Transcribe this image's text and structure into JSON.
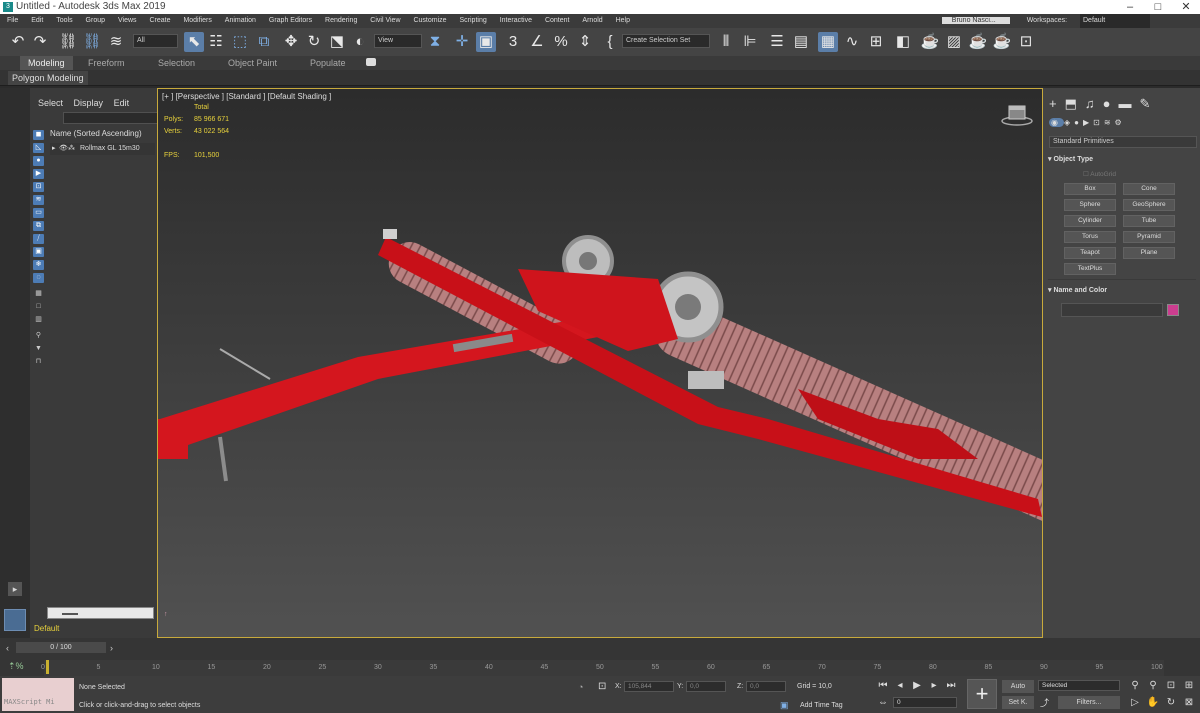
{
  "window": {
    "title": "Untitled - Autodesk 3ds Max 2019"
  },
  "menu": [
    "File",
    "Edit",
    "Tools",
    "Group",
    "Views",
    "Create",
    "Modifiers",
    "Animation",
    "Graph Editors",
    "Rendering",
    "Civil View",
    "Customize",
    "Scripting",
    "Interactive",
    "Content",
    "Arnold",
    "Help"
  ],
  "workspace": {
    "user": "Bruno Nasci...",
    "label": "Workspaces:",
    "value": "Default"
  },
  "toolbar": {
    "filter": "All",
    "coord": "View",
    "selection_set": "Create Selection Set"
  },
  "ribbon": {
    "tabs": [
      "Modeling",
      "Freeform",
      "Selection",
      "Object Paint",
      "Populate"
    ],
    "active": "Modeling",
    "subtab": "Polygon Modeling"
  },
  "scene_explorer": {
    "tabs": [
      "Select",
      "Display",
      "Edit"
    ],
    "column": "Name (Sorted Ascending)",
    "item": "Rollmax GL 15m30",
    "layer": "Default"
  },
  "viewport": {
    "label": "[+ ] [Perspective ] [Standard ] [Default Shading ]",
    "stats_title": "Total",
    "polys_label": "Polys:",
    "polys": "85 966 671",
    "verts_label": "Verts:",
    "verts": "43 022 564",
    "fps_label": "FPS:",
    "fps": "101,500"
  },
  "command_panel": {
    "dropdown": "Standard Primitives",
    "rollout_object_type": "Object Type",
    "autogrid": "AutoGrid",
    "buttons": [
      "Box",
      "Cone",
      "Sphere",
      "GeoSphere",
      "Cylinder",
      "Tube",
      "Torus",
      "Pyramid",
      "Teapot",
      "Plane",
      "TextPlus"
    ],
    "rollout_name_color": "Name and Color",
    "swatch_color": "#cc3d8f"
  },
  "timeline": {
    "frame": "0 / 100",
    "ticks": [
      "0",
      "5",
      "10",
      "15",
      "20",
      "25",
      "30",
      "35",
      "40",
      "45",
      "50",
      "55",
      "60",
      "65",
      "70",
      "75",
      "80",
      "85",
      "90",
      "95",
      "100"
    ]
  },
  "status": {
    "selection": "None Selected",
    "prompt": "Click or click-and-drag to select objects",
    "script_box": "MAXScript Mi",
    "x_label": "X:",
    "x": "105,844",
    "y_label": "Y:",
    "y": "0,0",
    "z_label": "Z:",
    "z": "0,0",
    "grid": "Grid = 10,0",
    "add_time_tag": "Add Time Tag",
    "auto": "Auto",
    "set_key": "Set K.",
    "selected": "Selected",
    "filters": "Filters...",
    "frame_field": "0"
  }
}
